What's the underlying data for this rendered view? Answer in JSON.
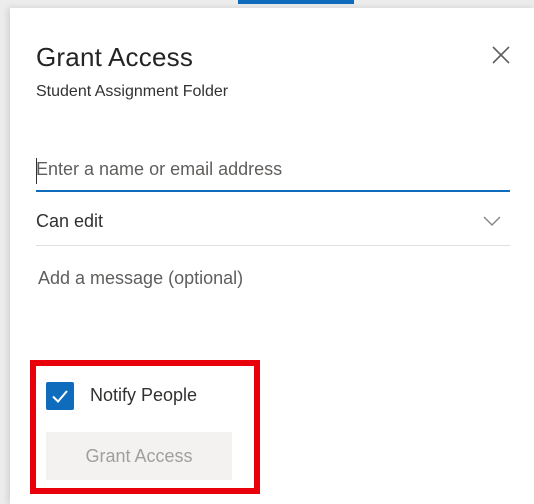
{
  "dialog": {
    "title": "Grant Access",
    "subtitle": "Student Assignment Folder",
    "close_icon": "close-icon"
  },
  "form": {
    "recipient": {
      "placeholder": "Enter a name or email address",
      "value": ""
    },
    "permission": {
      "selected": "Can edit",
      "icon": "chevron-down-icon"
    },
    "message": {
      "placeholder": "Add a message (optional)",
      "value": ""
    },
    "notify": {
      "label": "Notify People",
      "checked": true,
      "icon": "checkmark-icon"
    },
    "submit": {
      "label": "Grant Access",
      "enabled": false
    }
  },
  "annotation": {
    "highlight_color": "#e8000b"
  },
  "colors": {
    "accent": "#0f6cbd",
    "disabled_text": "#a19f9d",
    "disabled_bg": "#f3f2f1"
  }
}
